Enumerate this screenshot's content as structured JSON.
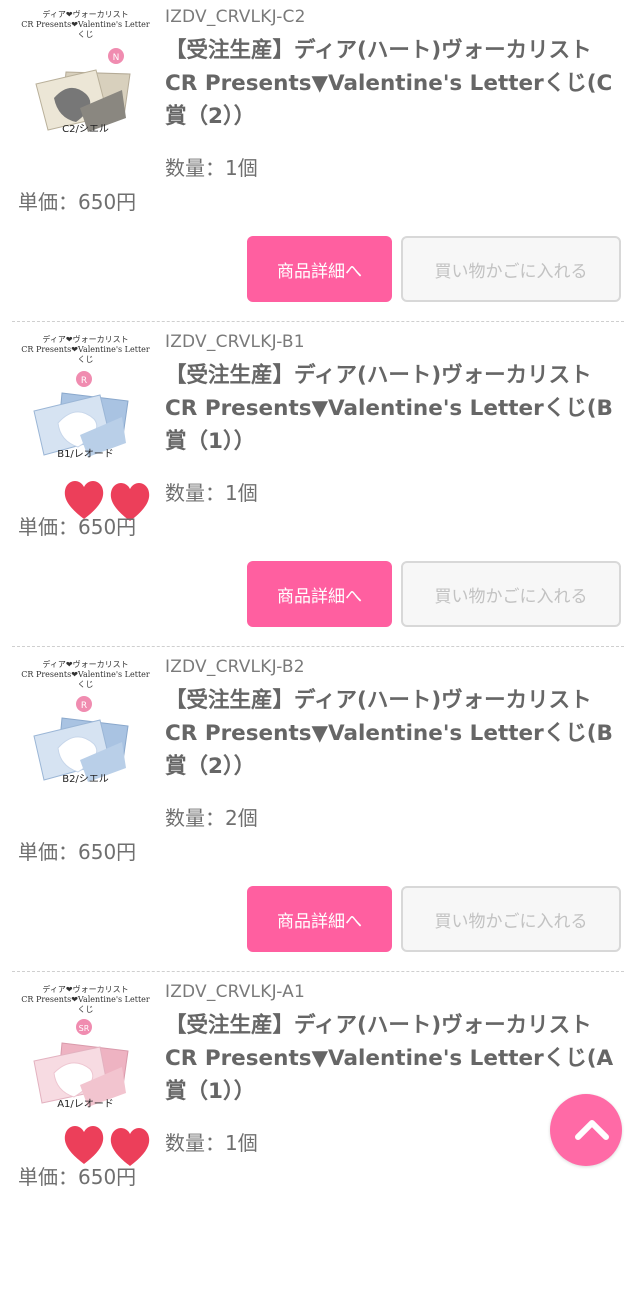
{
  "items": [
    {
      "thumb_header": "ディア❤ヴォーカリスト",
      "thumb_header2": "CR Presents❤Valentine's Letterくじ",
      "rarity": "N",
      "thumb_caption": "C2/シエル",
      "code": "IZDV_CRVLKJ-C2",
      "title": "【受注生産】ディア(ハート)ヴォーカリスト CR Presents▼Valentine's Letterくじ(C賞（2））",
      "quantity": "数量：1個",
      "unit_price": "単価：650円",
      "detail_label": "商品詳細へ",
      "cart_label": "買い物かごに入れる",
      "envelope_color": "#ece6d6",
      "card_color": "#e5e0d4"
    },
    {
      "thumb_header": "ディア❤ヴォーカリスト",
      "thumb_header2": "CR Presents❤Valentine's Letterくじ",
      "rarity": "R",
      "thumb_caption": "B1/レオード",
      "code": "IZDV_CRVLKJ-B1",
      "title": "【受注生産】ディア(ハート)ヴォーカリスト CR Presents▼Valentine's Letterくじ(B賞（1））",
      "quantity": "数量：1個",
      "unit_price": "単価：650円",
      "detail_label": "商品詳細へ",
      "cart_label": "買い物かごに入れる",
      "envelope_color": "#b9cfe8",
      "card_color": "#d6e3f2"
    },
    {
      "thumb_header": "ディア❤ヴォーカリスト",
      "thumb_header2": "CR Presents❤Valentine's Letterくじ",
      "rarity": "R",
      "thumb_caption": "B2/シエル",
      "code": "IZDV_CRVLKJ-B2",
      "title": "【受注生産】ディア(ハート)ヴォーカリスト CR Presents▼Valentine's Letterくじ(B賞（2））",
      "quantity": "数量：2個",
      "unit_price": "単価：650円",
      "detail_label": "商品詳細へ",
      "cart_label": "買い物かごに入れる",
      "envelope_color": "#b9cfe8",
      "card_color": "#d6e3f2"
    },
    {
      "thumb_header": "ディア❤ヴォーカリスト",
      "thumb_header2": "CR Presents❤Valentine's Letterくじ",
      "rarity": "SR",
      "thumb_caption": "A1/レオード",
      "code": "IZDV_CRVLKJ-A1",
      "title": "【受注生産】ディア(ハート)ヴォーカリスト CR Presents▼Valentine's Letterくじ(A賞（1））",
      "quantity": "数量：1個",
      "unit_price": "単価：650円",
      "detail_label": "商品詳細へ",
      "cart_label": "買い物かごに入れる",
      "envelope_color": "#f2c4cf",
      "card_color": "#f7dbe2"
    }
  ],
  "scroll_top_icon": "chevron-up-icon",
  "colors": {
    "accent_pink": "#ff5fa0",
    "heart_red": "#ec3f5a",
    "text_gray": "#6f6f6f"
  }
}
